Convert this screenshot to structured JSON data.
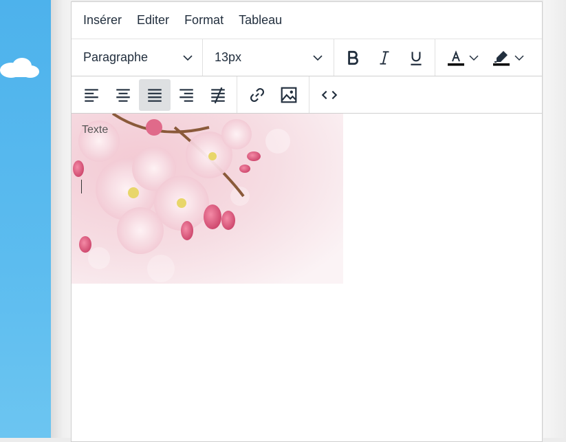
{
  "menubar": {
    "items": [
      "Insérer",
      "Editer",
      "Format",
      "Tableau"
    ]
  },
  "toolbar": {
    "block_format": "Paragraphe",
    "font_size": "13px",
    "bold_icon": "bold-icon",
    "italic_icon": "italic-icon",
    "underline_icon": "underline-icon",
    "text_color_icon": "text-color-icon",
    "highlight_icon": "highlight-icon"
  },
  "toolbar2": {
    "align_left": "align-left-icon",
    "align_center": "align-center-icon",
    "justify": "justify-icon",
    "align_right": "align-right-icon",
    "clear_format": "clear-format-icon",
    "link": "link-icon",
    "image": "image-icon",
    "code": "source-code-icon",
    "active": "justify"
  },
  "content": {
    "text": "Texte"
  },
  "colors": {
    "icon": "#222f3e",
    "active_bg": "#dee0e2",
    "sky": "#4db2ec"
  }
}
